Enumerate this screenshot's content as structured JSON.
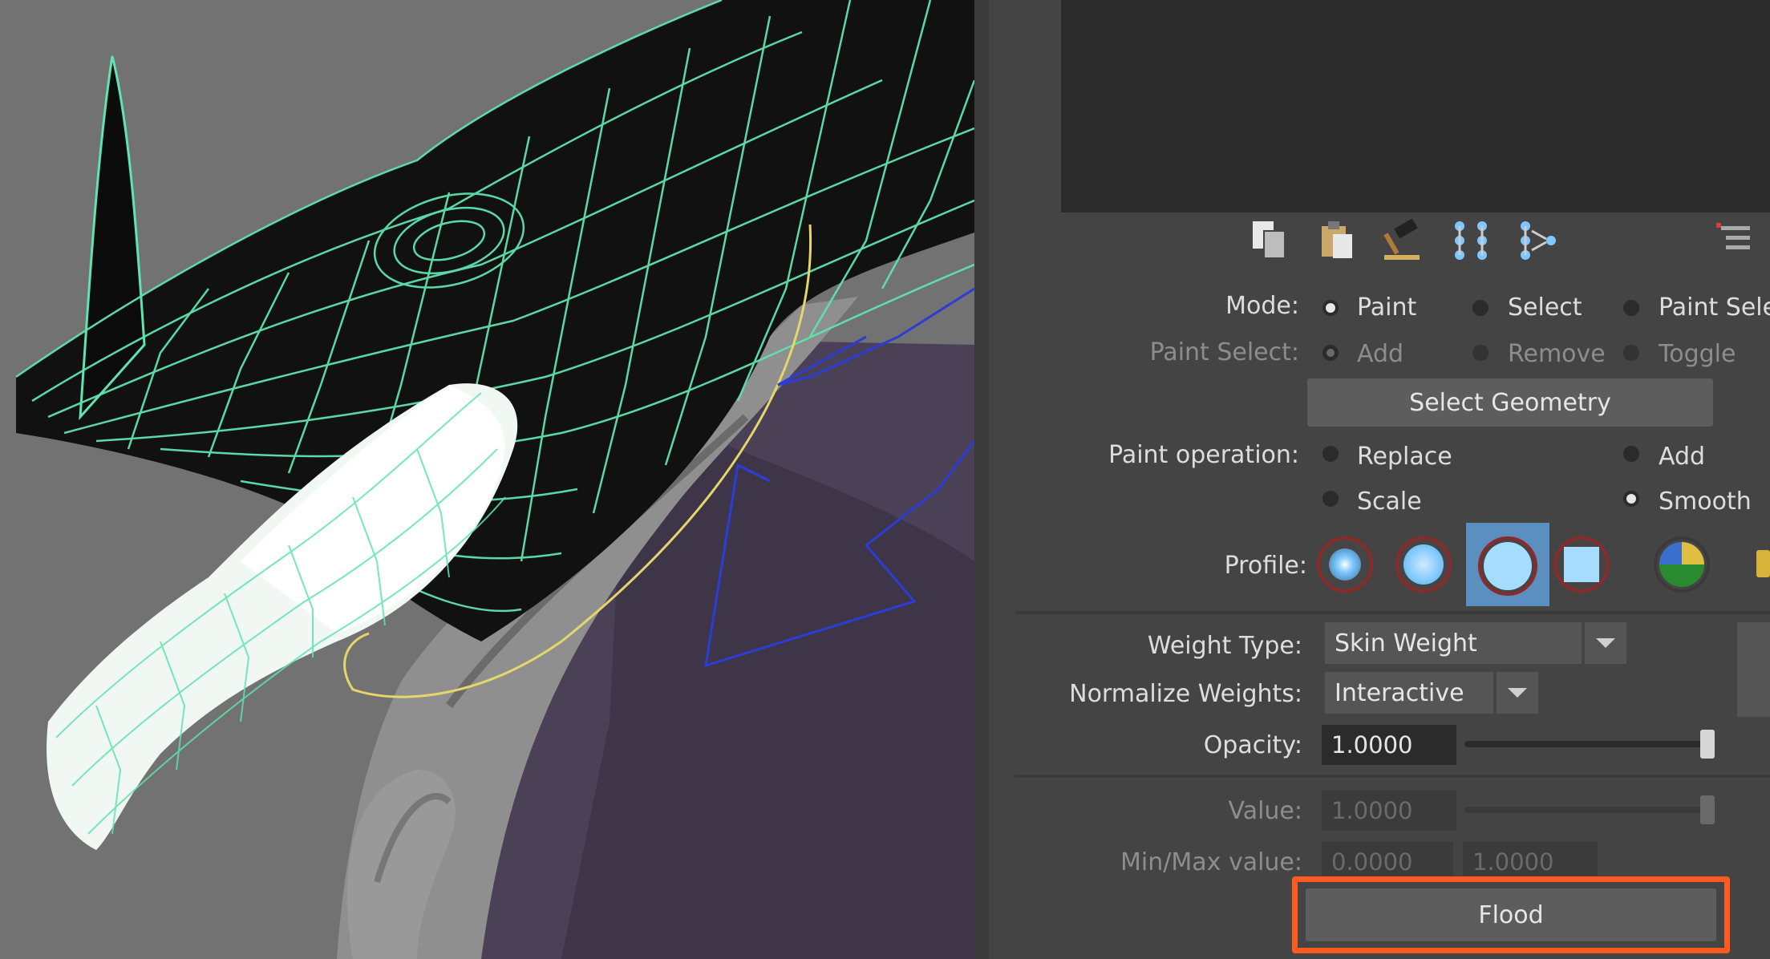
{
  "paint_tool": {
    "mode": {
      "label": "Mode:",
      "options": [
        "Paint",
        "Select",
        "Paint Sele"
      ],
      "selected": "Paint"
    },
    "paint_select": {
      "label": "Paint Select:",
      "options": [
        "Add",
        "Remove",
        "Toggle"
      ]
    },
    "select_geometry_label": "Select Geometry",
    "paint_operation": {
      "label": "Paint operation:",
      "options": [
        "Replace",
        "Add",
        "Scale",
        "Smooth"
      ],
      "selected": "Smooth"
    },
    "profile_label": "Profile:",
    "weight_type": {
      "label": "Weight Type:",
      "value": "Skin Weight"
    },
    "normalize_weights": {
      "label": "Normalize Weights:",
      "value": "Interactive"
    },
    "opacity": {
      "label": "Opacity:",
      "value": "1.0000",
      "level": 1.0
    },
    "value": {
      "label": "Value:",
      "value": "1.0000",
      "level": 1.0
    },
    "min_max": {
      "label": "Min/Max value:",
      "min": "0.0000",
      "max": "1.0000"
    },
    "flood_label": "Flood"
  },
  "toolbar_icons": [
    "copy-weights-icon",
    "paste-weights-icon",
    "weight-hammer-icon",
    "mirror-weights-icon",
    "transfer-weights-icon"
  ],
  "colors": {
    "wireframe": "#5fe3b0",
    "highlight": "#ff5a1f",
    "profile_blue": "#7fc8ff"
  }
}
